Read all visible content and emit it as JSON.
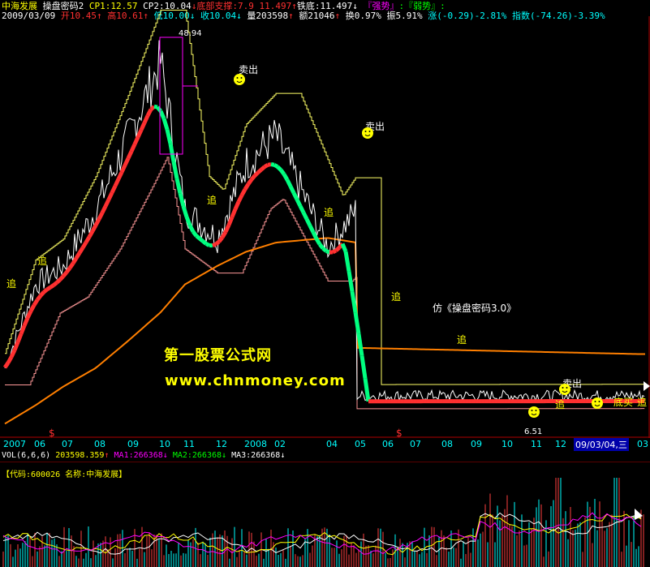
{
  "header": {
    "stock_name": "中海发展",
    "indicator": "操盘密码2",
    "cp1_label": "CP1:12.57",
    "cp2_label": "CP2:10.04",
    "cp2_arrow": "↓",
    "support_label": "底部支撑:7.9",
    "support_value": "11.497",
    "support_arrow": "↑",
    "iron_label": "铁底:11.497",
    "iron_arrow": "↓",
    "strong_label": "『强势』",
    "weak_label": ":『弱势』:",
    "date": "2009/03/09",
    "open": "开10.45",
    "open_arrow": "↑",
    "high": "高10.61",
    "high_arrow": "↑",
    "low": "低10.00",
    "low_arrow": "↓",
    "close": "收10.04",
    "close_arrow": "↓",
    "volume": "量203598",
    "volume_arrow": "↑",
    "amount": "额21046",
    "amount_arrow": "↑",
    "turnover": "换0.97%",
    "amplitude": "振5.91%",
    "change": "涨(-0.29)-2.81%",
    "index": "指数(-74.26)-3.39%"
  },
  "annotations": {
    "peak_label": "48.94",
    "low_label": "6.51",
    "sell": "卖出",
    "chase": "追",
    "imitation": "仿《操盘密码3.0》",
    "bottom_chase": "底买",
    "dollar": "$"
  },
  "watermark": {
    "line1": "第一股票公式网",
    "line2": "www.chnmoney.com"
  },
  "volume_header": {
    "vol": "VOL(6,6,6)",
    "vol_value": "203598.359",
    "vol_arrow": "↑",
    "ma1": "MA1:266368",
    "ma1_arrow": "↓",
    "ma2": "MA2:266368",
    "ma2_arrow": "↓",
    "ma3": "MA3:266368",
    "ma3_arrow": "↓"
  },
  "code_header": "【代码:600026 名称:中海发展】",
  "colors": {
    "background": "#000000",
    "up": "#ff3030",
    "down": "#00ff80",
    "price": "#ffffff",
    "ma_orange": "#ff7f00",
    "upper_band": "#ffff66",
    "lower_band": "#ff9999",
    "volume": "#ff4040"
  },
  "chart_data": {
    "type": "line",
    "title": "中海发展 操盘密码2",
    "x_ticks": [
      "2007",
      "06",
      "07",
      "08",
      "09",
      "10",
      "11",
      "12",
      "2008",
      "02",
      "04",
      "05",
      "06",
      "07",
      "08",
      "09",
      "10",
      "11",
      "12",
      "09/03/04,三",
      "03"
    ],
    "current_date_label": "09/03/04,三",
    "price_min": 6.51,
    "price_max": 48.94,
    "series": [
      {
        "name": "收",
        "x": [
          "2007",
          "06",
          "07",
          "08",
          "09",
          "10",
          "11",
          "12",
          "2008",
          "02",
          "04",
          "05",
          "06",
          "07",
          "08",
          "09",
          "10",
          "11",
          "12",
          "03"
        ],
        "values": [
          13,
          22,
          24,
          30,
          38,
          46,
          30,
          27,
          35,
          38,
          26,
          30,
          26,
          17,
          14,
          9,
          7,
          8,
          10,
          10.04
        ]
      },
      {
        "name": "MA",
        "x": [
          "2007",
          "06",
          "07",
          "08",
          "09",
          "10",
          "11",
          "12",
          "2008",
          "02",
          "04",
          "05",
          "06",
          "07",
          "08",
          "09",
          "10",
          "11",
          "12",
          "03"
        ],
        "values": [
          7,
          9,
          11,
          13,
          16,
          19,
          22,
          24,
          25.5,
          26.5,
          27,
          26.5,
          25.8,
          24.5,
          23,
          21,
          19,
          17,
          15.5,
          14.5
        ]
      }
    ],
    "volume": {
      "name": "VOL",
      "last": 203598.359,
      "ma1": 266368,
      "ma2": 266368,
      "ma3": 266368
    }
  }
}
